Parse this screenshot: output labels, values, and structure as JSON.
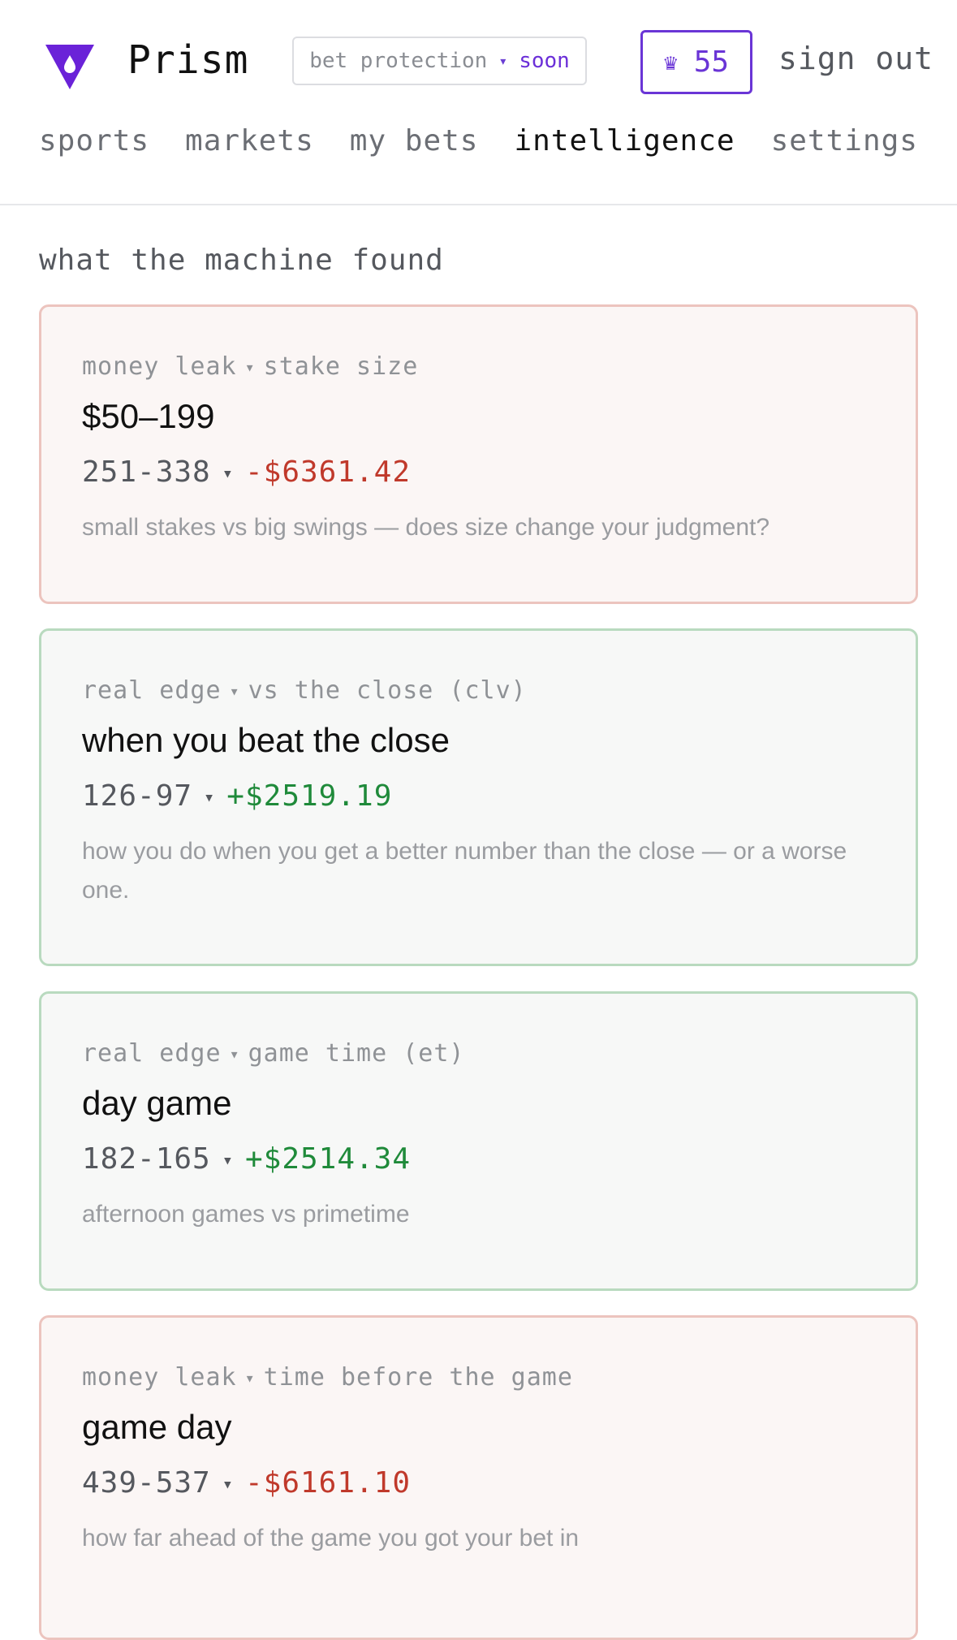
{
  "header": {
    "brand": "Prism",
    "promo": {
      "label": "bet protection",
      "separator": "▾",
      "status": "soon"
    },
    "credits": {
      "icon": "crown-icon",
      "glyph": "♛",
      "value": "55"
    },
    "signout_label": "sign out"
  },
  "nav": {
    "tabs": [
      {
        "label": "sports",
        "active": false
      },
      {
        "label": "markets",
        "active": false
      },
      {
        "label": "my bets",
        "active": false
      },
      {
        "label": "intelligence",
        "active": true
      },
      {
        "label": "settings",
        "active": false
      }
    ]
  },
  "main": {
    "section_title": "what the machine found",
    "cards": [
      {
        "kind": "money leak",
        "category": "stake size",
        "title": "$50–199",
        "record": "251-338",
        "pnl": "-$6361.42",
        "desc": "small stakes vs big swings — does size change your judgment?"
      },
      {
        "kind": "real edge",
        "category": "vs the close (clv)",
        "title": "when you beat the close",
        "record": "126-97",
        "pnl": "+$2519.19",
        "desc": "how you do when you get a better number than the close — or a worse one."
      },
      {
        "kind": "real edge",
        "category": "game time (et)",
        "title": "day game",
        "record": "182-165",
        "pnl": "+$2514.34",
        "desc": "afternoon games vs primetime"
      },
      {
        "kind": "money leak",
        "category": "time before the game",
        "title": "game day",
        "record": "439-537",
        "pnl": "-$6161.10",
        "desc": "how far ahead of the game you got your bet in"
      }
    ],
    "separator": "▾"
  },
  "colors": {
    "accent": "#6a35d6",
    "leak_border": "#ecc4be",
    "leak_bg": "#fbf6f5",
    "edge_border": "#b9dabf",
    "edge_bg": "#f7f8f7",
    "negative": "#c0392b",
    "positive": "#1f8a3a"
  }
}
